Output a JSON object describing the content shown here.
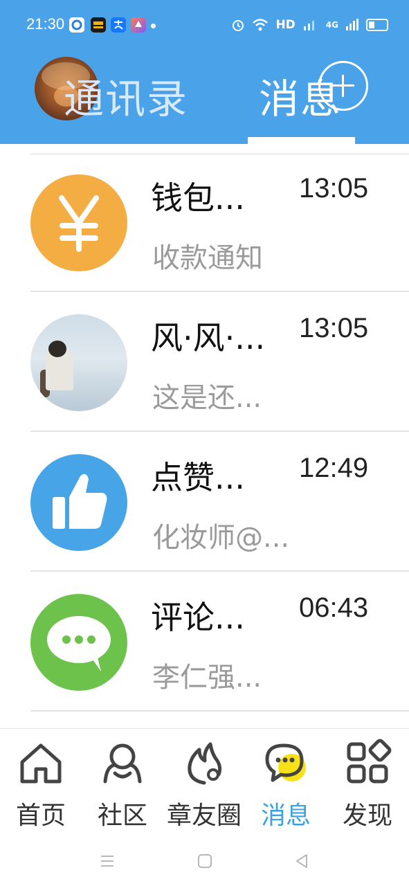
{
  "status_bar": {
    "time": "21:30",
    "network": "HD",
    "signal": "4G"
  },
  "header": {
    "tabs": [
      {
        "label": "通讯录",
        "active": false
      },
      {
        "label": "消息",
        "active": true
      }
    ],
    "add_icon": "plus-circle-icon",
    "accent_color": "#4aa3e8"
  },
  "messages": [
    {
      "title": "钱包...",
      "preview": "收款通知",
      "time": "13:05",
      "icon": "yen-icon",
      "color": "#f3ad43"
    },
    {
      "title": "风·风·...",
      "preview": "这是还...",
      "time": "13:05",
      "icon": "avatar-photo",
      "color": "#cfdde7"
    },
    {
      "title": "点赞...",
      "preview": "化妆师@...",
      "time": "12:49",
      "icon": "thumbs-up-icon",
      "color": "#47a4e6"
    },
    {
      "title": "评论...",
      "preview": "李仁强...",
      "time": "06:43",
      "icon": "chat-bubble-icon",
      "color": "#6cc24a"
    }
  ],
  "bottom_nav": {
    "items": [
      {
        "label": "首页",
        "icon": "home-icon",
        "active": false
      },
      {
        "label": "社区",
        "icon": "community-icon",
        "active": false
      },
      {
        "label": "章友圈",
        "icon": "flame-icon",
        "active": false
      },
      {
        "label": "消息",
        "icon": "message-icon",
        "active": true
      },
      {
        "label": "发现",
        "icon": "discover-grid-icon",
        "active": false
      }
    ],
    "active_color": "#3aa3df"
  },
  "system_nav": {
    "buttons": [
      "menu-icon",
      "home-square-icon",
      "back-triangle-icon"
    ]
  }
}
